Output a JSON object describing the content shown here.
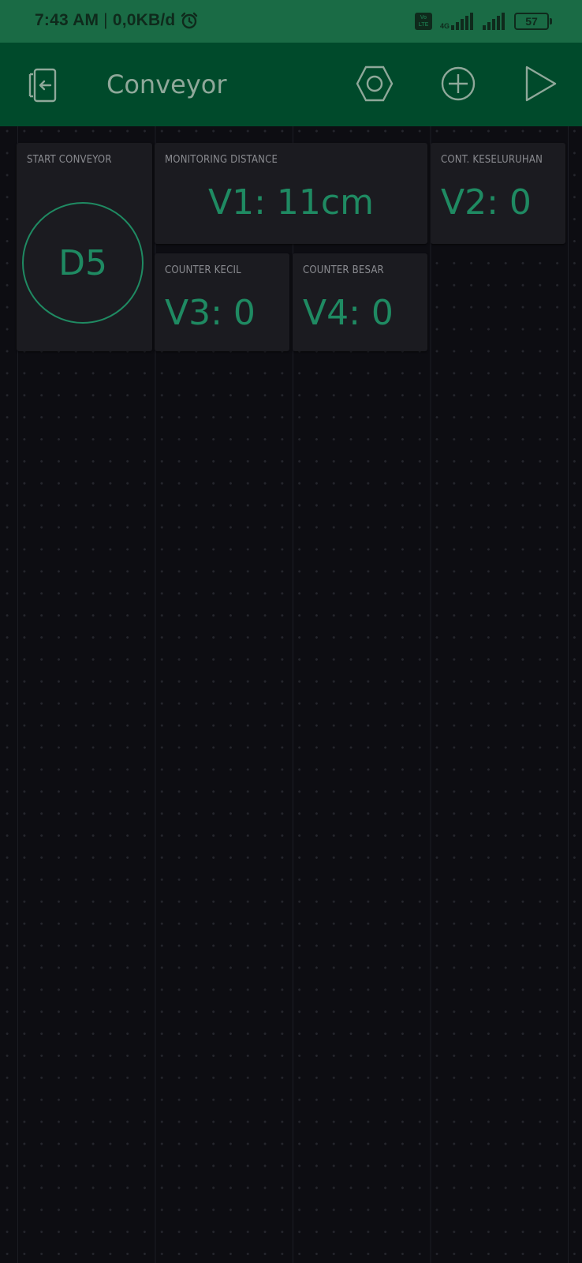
{
  "status_bar": {
    "time": "7:43 AM",
    "separator": "|",
    "data_rate": "0,0KB/d",
    "volte_top": "Vo",
    "volte_bottom": "LTE",
    "network": "4G",
    "battery": "57"
  },
  "header": {
    "title": "Conveyor",
    "icons": [
      "exit-icon",
      "settings-hexagon-icon",
      "add-icon",
      "play-icon"
    ]
  },
  "widgets": {
    "start_conveyor": {
      "label": "START CONVEYOR",
      "value": "D5"
    },
    "monitoring_distance": {
      "label": "MONITORING DISTANCE",
      "value": "V1: 11cm"
    },
    "cont_keseluruhan": {
      "label": "CONT. KESELURUHAN",
      "value": "V2: 0"
    },
    "counter_kecil": {
      "label": "COUNTER KECIL",
      "value": "V3: 0"
    },
    "counter_besar": {
      "label": "COUNTER BESAR",
      "value": "V4: 0"
    }
  },
  "colors": {
    "status_bar": "#1a6b45",
    "app_bar": "#004a2b",
    "background": "#0d0d12",
    "widget": "#1b1b20",
    "accent": "#1f8a62"
  }
}
